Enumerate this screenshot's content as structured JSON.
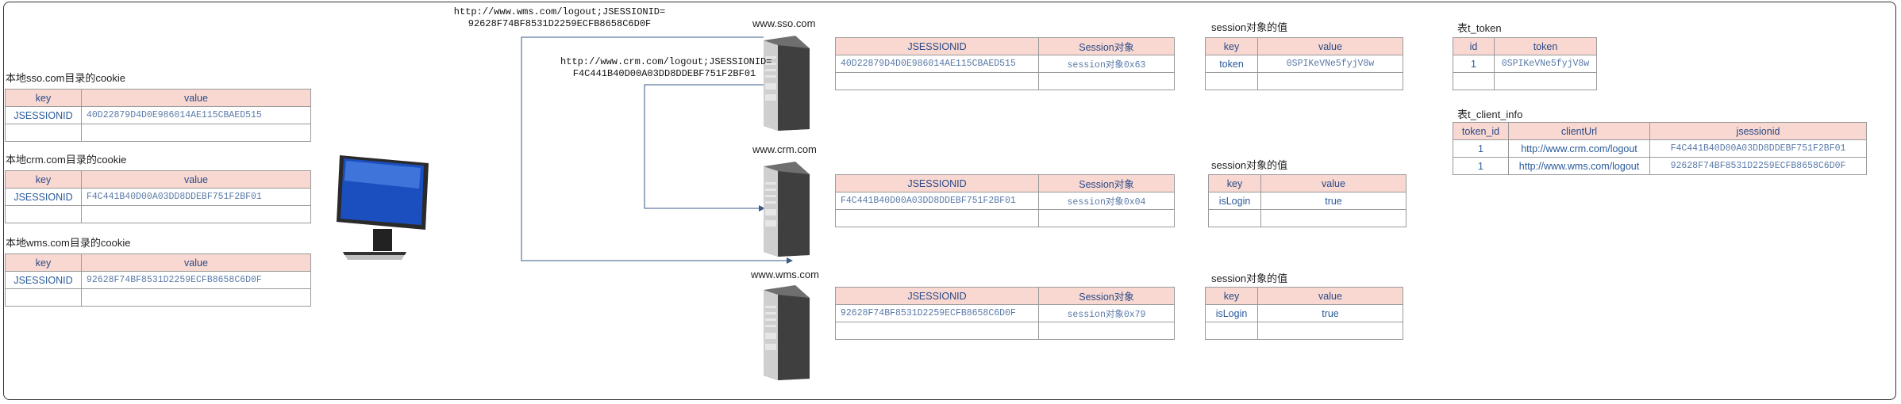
{
  "browser": {
    "sso_cookie_caption": "本地sso.com目录的cookie",
    "crm_cookie_caption": "本地crm.com目录的cookie",
    "wms_cookie_caption": "本地wms.com目录的cookie",
    "cookie_headers": [
      "key",
      "value"
    ],
    "sso_cookie": {
      "key": "JSESSIONID",
      "value": "40D22879D4D0E986014AE115CBAED515"
    },
    "crm_cookie": {
      "key": "JSESSIONID",
      "value": "F4C441B40D00A03DD8DDEBF751F2BF01"
    },
    "wms_cookie": {
      "key": "JSESSIONID",
      "value": "92628F74BF8531D2259ECFB8658C6D0F"
    },
    "monitor_icon": "monitor-icon"
  },
  "requests": {
    "wms_logout_line1": "http://www.wms.com/logout;JSESSIONID=",
    "wms_logout_line2": "92628F74BF8531D2259ECFB8658C6D0F",
    "crm_logout_line1": "http://www.crm.com/logout;JSESSIONID=",
    "crm_logout_line2": "F4C441B40D00A03DD8DDEBF751F2BF01"
  },
  "servers": {
    "sso_label": "www.sso.com",
    "crm_label": "www.crm.com",
    "wms_label": "www.wms.com",
    "server_icon": "server-tower-icon"
  },
  "session_tables": {
    "headers": [
      "JSESSIONID",
      "Session对象"
    ],
    "sso": {
      "id": "40D22879D4D0E986014AE115CBAED515",
      "obj": "session对象0x63"
    },
    "crm": {
      "id": "F4C441B40D00A03DD8DDEBF751F2BF01",
      "obj": "session对象0x04"
    },
    "wms": {
      "id": "92628F74BF8531D2259ECFB8658C6D0F",
      "obj": "session对象0x79"
    }
  },
  "session_values": {
    "caption": "session对象的值",
    "headers": [
      "key",
      "value"
    ],
    "sso": {
      "key": "token",
      "value": "0SPIKeVNe5fyjV8w"
    },
    "crm": {
      "key": "isLogin",
      "value": "true"
    },
    "wms": {
      "key": "isLogin",
      "value": "true"
    }
  },
  "db_token": {
    "caption": "表t_token",
    "headers": [
      "id",
      "token"
    ],
    "rows": [
      {
        "id": "1",
        "token": "0SPIKeVNe5fyjV8w"
      }
    ]
  },
  "db_client_info": {
    "caption": "表t_client_info",
    "headers": [
      "token_id",
      "clientUrl",
      "jsessionid"
    ],
    "rows": [
      {
        "token_id": "1",
        "clientUrl": "http://www.crm.com/logout",
        "jsessionid": "F4C441B40D00A03DD8DDEBF751F2BF01"
      },
      {
        "token_id": "1",
        "clientUrl": "http://www.wms.com/logout",
        "jsessionid": "92628F74BF8531D2259ECFB8658C6D0F"
      }
    ]
  },
  "colors": {
    "header_fill": "#f8d8d0",
    "header_text": "#2a4a8a",
    "cell_text": "#2a5a9a",
    "arrow": "#3a5a8a"
  }
}
